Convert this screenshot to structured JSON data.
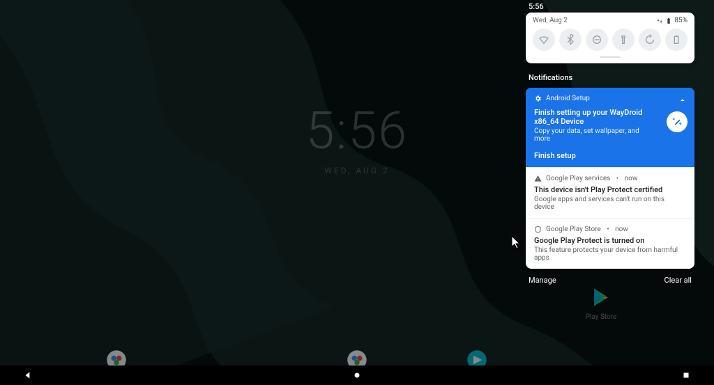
{
  "statusbar": {
    "time": "5:56"
  },
  "quicksettings": {
    "date": "Wed, Aug 2",
    "battery": "85%"
  },
  "homescreen": {
    "clock_time": "5:56",
    "clock_date": "WED, AUG 2",
    "play_store_label": "Play Store"
  },
  "notifications": {
    "section_label": "Notifications",
    "manage_label": "Manage",
    "clear_label": "Clear all",
    "setup": {
      "app_name": "Android Setup",
      "title": "Finish setting up your WayDroid x86_64 Device",
      "body": "Copy your data, set wallpaper, and more",
      "action": "Finish setup"
    },
    "items": [
      {
        "app_name": "Google Play services",
        "time": "now",
        "title": "This device isn't Play Protect certified",
        "body": "Google apps and services can't run on this device"
      },
      {
        "app_name": "Google Play Store",
        "time": "now",
        "title": "Google Play Protect is turned on",
        "body": "This feature protects your device from harmful apps"
      }
    ]
  }
}
